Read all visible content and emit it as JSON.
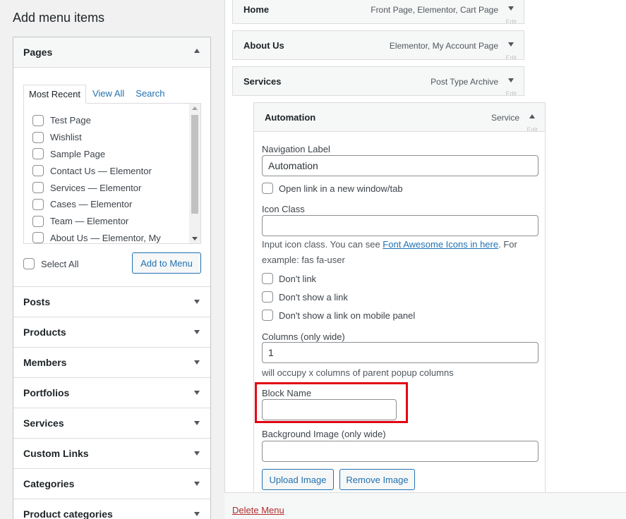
{
  "left_panel": {
    "title": "Add menu items",
    "pages": {
      "heading": "Pages",
      "tabs": [
        "Most Recent",
        "View All",
        "Search"
      ],
      "items": [
        "Test Page",
        "Wishlist",
        "Sample Page",
        "Contact Us — Elementor",
        "Services — Elementor",
        "Cases — Elementor",
        "Team — Elementor",
        "About Us — Elementor, My"
      ],
      "select_all": "Select All",
      "add_button": "Add to Menu"
    },
    "sections": [
      "Posts",
      "Products",
      "Members",
      "Portfolios",
      "Services",
      "Custom Links",
      "Categories",
      "Product categories"
    ]
  },
  "menu_structure": {
    "items": [
      {
        "title": "Home",
        "type": "Front Page, Elementor, Cart Page",
        "edit": "Edit"
      },
      {
        "title": "About Us",
        "type": "Elementor, My Account Page",
        "edit": "Edit"
      },
      {
        "title": "Services",
        "type": "Post Type Archive",
        "edit": "Edit"
      }
    ],
    "open_item": {
      "title": "Automation",
      "type": "Service",
      "edit": "Edit",
      "fields": {
        "navigation_label": "Navigation Label",
        "navigation_value": "Automation",
        "open_new_window": "Open link in a new window/tab",
        "icon_class": "Icon Class",
        "icon_value": "",
        "icon_desc_prefix": "Input icon class. You can see ",
        "icon_desc_link": "Font Awesome Icons in here",
        "icon_desc_suffix": ". For example: fas fa-user",
        "dont_link": "Don't link",
        "dont_show_link": "Don't show a link",
        "dont_show_mobile": "Don't show a link on mobile panel",
        "columns_label": "Columns (only wide)",
        "columns_value": "1",
        "columns_desc": "will occupy x columns of parent popup columns",
        "block_name": "Block Name",
        "block_value": "",
        "background_image": "Background Image (only wide)",
        "background_value": "",
        "upload_button": "Upload Image",
        "remove_button": "Remove Image"
      }
    },
    "delete_menu": "Delete Menu"
  },
  "colors": {
    "link": "#2271b1",
    "highlight": "#e30613",
    "delete": "#b32d2e"
  }
}
